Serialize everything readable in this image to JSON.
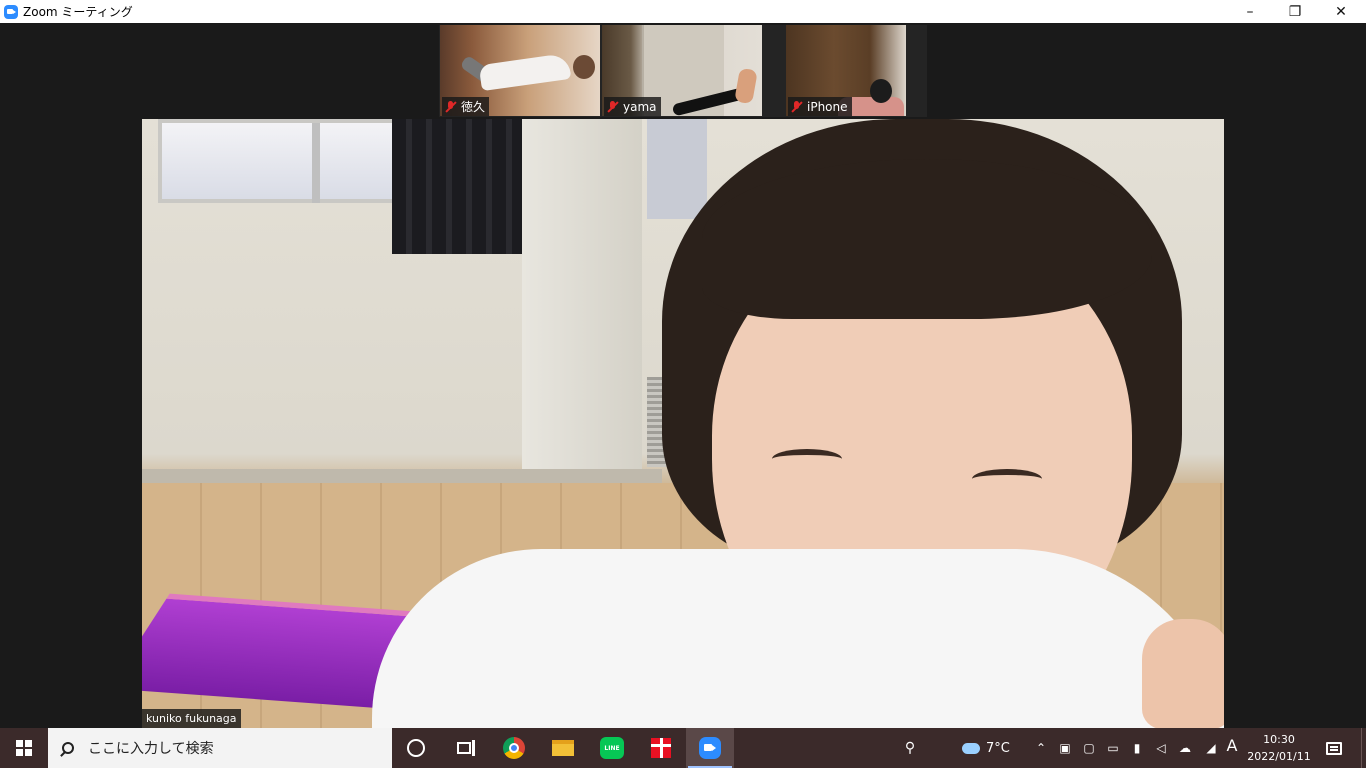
{
  "window": {
    "title": "Zoom ミーティング",
    "controls": {
      "minimize": "–",
      "maximize": "❐",
      "close": "✕"
    }
  },
  "participants": [
    {
      "name": "徳久",
      "muted": true
    },
    {
      "name": "yama",
      "muted": true
    },
    {
      "name": "iPhone",
      "muted": true
    }
  ],
  "active_speaker": {
    "name": "kuniko fukunaga"
  },
  "taskbar": {
    "search_placeholder": "ここに入力して検索",
    "apps": [
      "search-icon",
      "cortana-icon",
      "task-view-icon",
      "chrome-icon",
      "file-explorer-icon",
      "line-icon",
      "gift-icon",
      "zoom-icon"
    ],
    "weather": "7°C",
    "ime": "A",
    "clock_time": "10:30",
    "clock_date": "2022/01/11",
    "accent_color": "#3b2a2a"
  }
}
